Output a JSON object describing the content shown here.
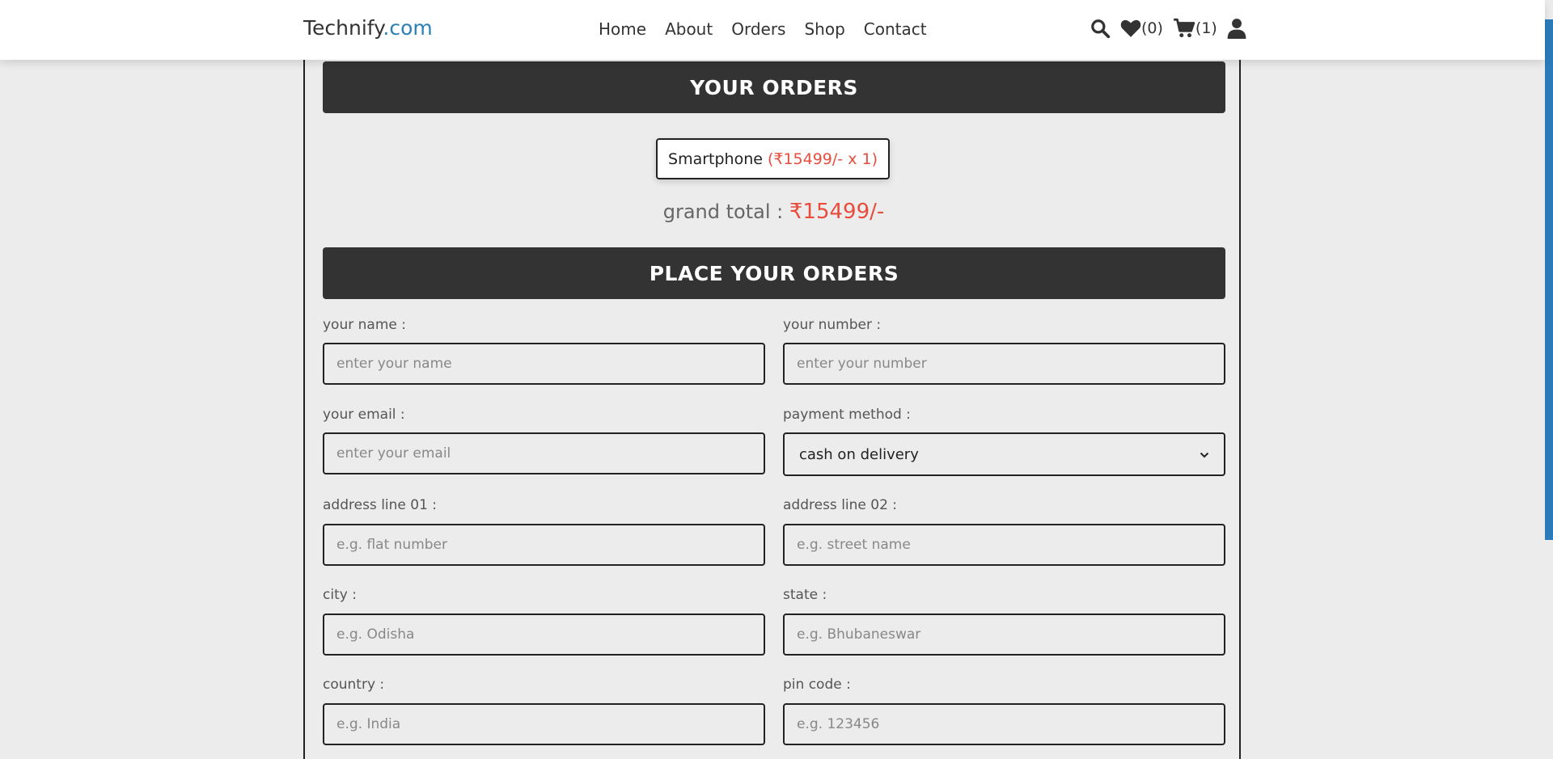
{
  "header": {
    "logo_main": "Technify",
    "logo_accent": ".com",
    "nav": [
      "Home",
      "About",
      "Orders",
      "Shop",
      "Contact"
    ],
    "wishlist_count": "(0)",
    "cart_count": "(1)"
  },
  "orders": {
    "heading": "YOUR ORDERS",
    "item_name": "Smartphone",
    "item_price": "(₹15499/- x 1)",
    "grand_total_label": "grand total :",
    "grand_total_value": "₹15499/-"
  },
  "form": {
    "heading": "PLACE YOUR ORDERS",
    "name_label": "your name :",
    "name_placeholder": "enter your name",
    "number_label": "your number :",
    "number_placeholder": "enter your number",
    "email_label": "your email :",
    "email_placeholder": "enter your email",
    "payment_label": "payment method :",
    "payment_value": "cash on delivery",
    "address1_label": "address line 01 :",
    "address1_placeholder": "e.g. flat number",
    "address2_label": "address line 02 :",
    "address2_placeholder": "e.g. street name",
    "city_label": "city :",
    "city_placeholder": "e.g. Odisha",
    "state_label": "state :",
    "state_placeholder": "e.g. Bhubaneswar",
    "country_label": "country :",
    "country_placeholder": "e.g. India",
    "pincode_label": "pin code :",
    "pincode_placeholder": "e.g. 123456"
  },
  "colors": {
    "accent": "#2980b9",
    "price": "#e74c3c",
    "heading_bg": "#333333",
    "page_bg": "#ececec"
  },
  "icons": [
    "search-icon",
    "heart-icon",
    "cart-icon",
    "user-icon",
    "chevron-down-icon"
  ]
}
